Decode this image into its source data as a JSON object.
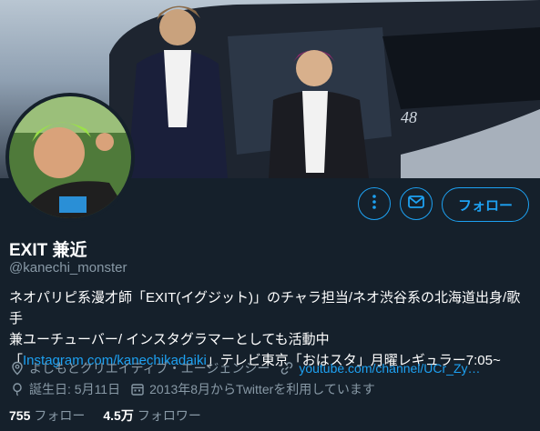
{
  "profile": {
    "display_name": "EXIT 兼近",
    "handle": "@kanechi_monster",
    "bio_line1": "ネオパリピ系漫才師「EXIT(イグジット)」のチャラ担当/ネオ渋谷系の北海道出身/歌手",
    "bio_line2": "兼ユーチューバー/ インスタグラマーとしても活動中",
    "bio_line3_prefix": "「",
    "bio_link": "Instagram.com/kanechikadaiki",
    "bio_line3_suffix": "」テレビ東京「おはスタ」月曜レギュラー7:05~",
    "location": "よしもとクリエイティブ・エージェンシー",
    "website": "youtube.com/channel/UCr_Zy…",
    "birthday": "誕生日: 5月11日",
    "joined": "2013年8月からTwitterを利用しています"
  },
  "stats": {
    "following_count": "755",
    "following_label": "フォロー",
    "followers_count": "4.5万",
    "followers_label": "フォロワー"
  },
  "actions": {
    "follow_label": "フォロー"
  },
  "icons": [
    "more-icon",
    "message-icon",
    "location-icon",
    "link-icon",
    "birthday-icon",
    "calendar-icon"
  ],
  "colors": {
    "background": "#15202b",
    "accent": "#1da1f2",
    "secondary_text": "#8899a6"
  }
}
